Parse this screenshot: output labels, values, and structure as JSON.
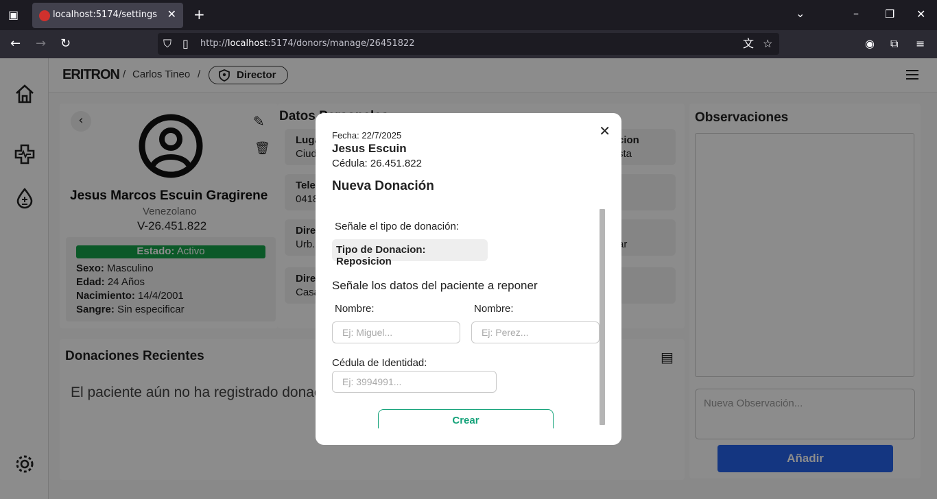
{
  "browser": {
    "tab_title": "localhost:5174/settings",
    "url_prefix": "http://",
    "url_host": "localhost",
    "url_rest": ":5174/donors/manage/26451822"
  },
  "header": {
    "logo_text": "ERITRON",
    "user_name": "Carlos Tineo",
    "role": "Director",
    "separator": "/"
  },
  "profile": {
    "full_name": "Jesus Marcos Escuin Gragirene",
    "nationality": "Venezolano",
    "id_number": "V-26.451.822",
    "estado_label": "Estado:",
    "estado_value": "Activo",
    "sexo_label": "Sexo:",
    "sexo_value": "Masculino",
    "edad_label": "Edad:",
    "edad_value": "24 Años",
    "nacimiento_label": "Nacimiento:",
    "nacimiento_value": "14/4/2001",
    "sangre_label": "Sangre:",
    "sangre_value": "Sin especificar"
  },
  "datos": {
    "title": "Datos Personales",
    "tiles": [
      {
        "label": "Lugar",
        "value": "Ciudad"
      },
      {
        "label": "Telefono",
        "value": "0418"
      },
      {
        "label": "Direccion",
        "value": "Urb."
      },
      {
        "label": "Direccion",
        "value": "Casa"
      }
    ],
    "right_tiles": [
      {
        "label": "cion",
        "value": "sta"
      },
      {
        "label": "",
        "value": "ar"
      }
    ]
  },
  "donaciones": {
    "title": "Donaciones Recientes",
    "empty_text": "El paciente aún no ha registrado donaciones"
  },
  "observaciones": {
    "title": "Observaciones",
    "new_placeholder": "Nueva Observación...",
    "add_button": "Añadir"
  },
  "modal": {
    "fecha": "Fecha: 22/7/2025",
    "donor_name": "Jesus Escuin",
    "cedula": "Cédula: 26.451.822",
    "title": "Nueva Donación",
    "tipo_prompt": "Señale el tipo de donación:",
    "tipo_value": "Tipo de Donacion: Reposicion",
    "paciente_prompt": "Señale los datos del paciente a reponer",
    "nombre_label": "Nombre:",
    "nombre_placeholder": "Ej: Miguel...",
    "apellido_label": "Nombre:",
    "apellido_placeholder": "Ej: Perez...",
    "cedula_label": "Cédula de Identidad:",
    "cedula_placeholder": "Ej: 3994991...",
    "submit_label": "Crear"
  },
  "colors": {
    "accent_green": "#15a37a",
    "status_green": "#15a34a",
    "button_blue": "#2563eb"
  }
}
